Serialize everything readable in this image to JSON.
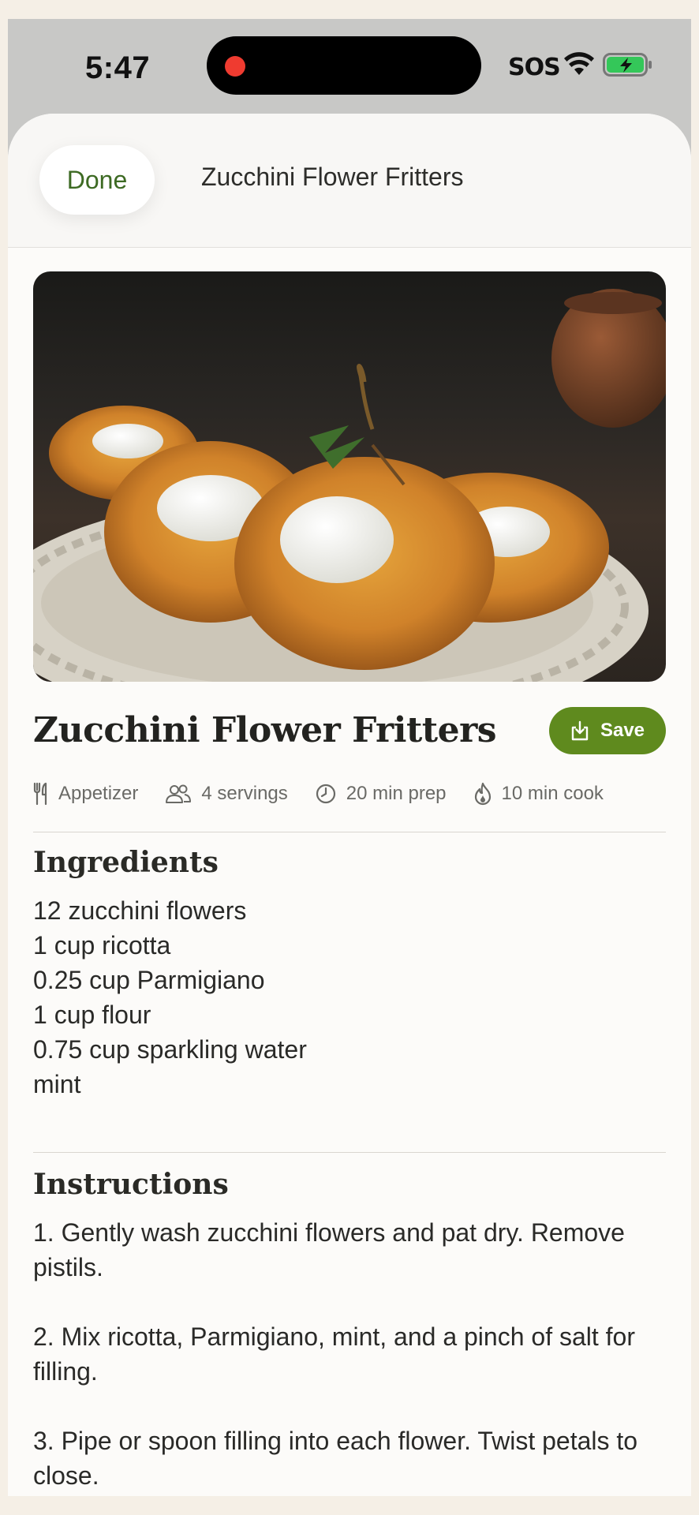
{
  "status_bar": {
    "time": "5:47",
    "sos": "SOS",
    "icons": [
      "recording-dot-icon",
      "wifi-icon",
      "battery-charging-icon"
    ]
  },
  "nav": {
    "done_label": "Done",
    "title": "Zucchini Flower Fritters"
  },
  "recipe": {
    "title": "Zucchini Flower Fritters",
    "save_label": "Save",
    "meta": {
      "category": "Appetizer",
      "servings": "4 servings",
      "prep": "20 min prep",
      "cook": "10 min cook"
    },
    "ingredients_heading": "Ingredients",
    "ingredients": [
      "12 zucchini flowers",
      "1 cup ricotta",
      "0.25 cup Parmigiano",
      "1 cup flour",
      "0.75 cup sparkling water",
      "mint"
    ],
    "instructions_heading": "Instructions",
    "steps": [
      "1. Gently wash zucchini flowers and pat dry. Remove pistils.",
      "2. Mix ricotta, Parmigiano, mint, and a pinch of salt for filling.",
      "3. Pipe or spoon filling into each flower. Twist petals to close."
    ]
  },
  "colors": {
    "accent_green": "#5f8a1e",
    "done_text": "#3d6a23",
    "sheet_bg": "#fcfbf9",
    "page_bg": "#f5efe6"
  }
}
